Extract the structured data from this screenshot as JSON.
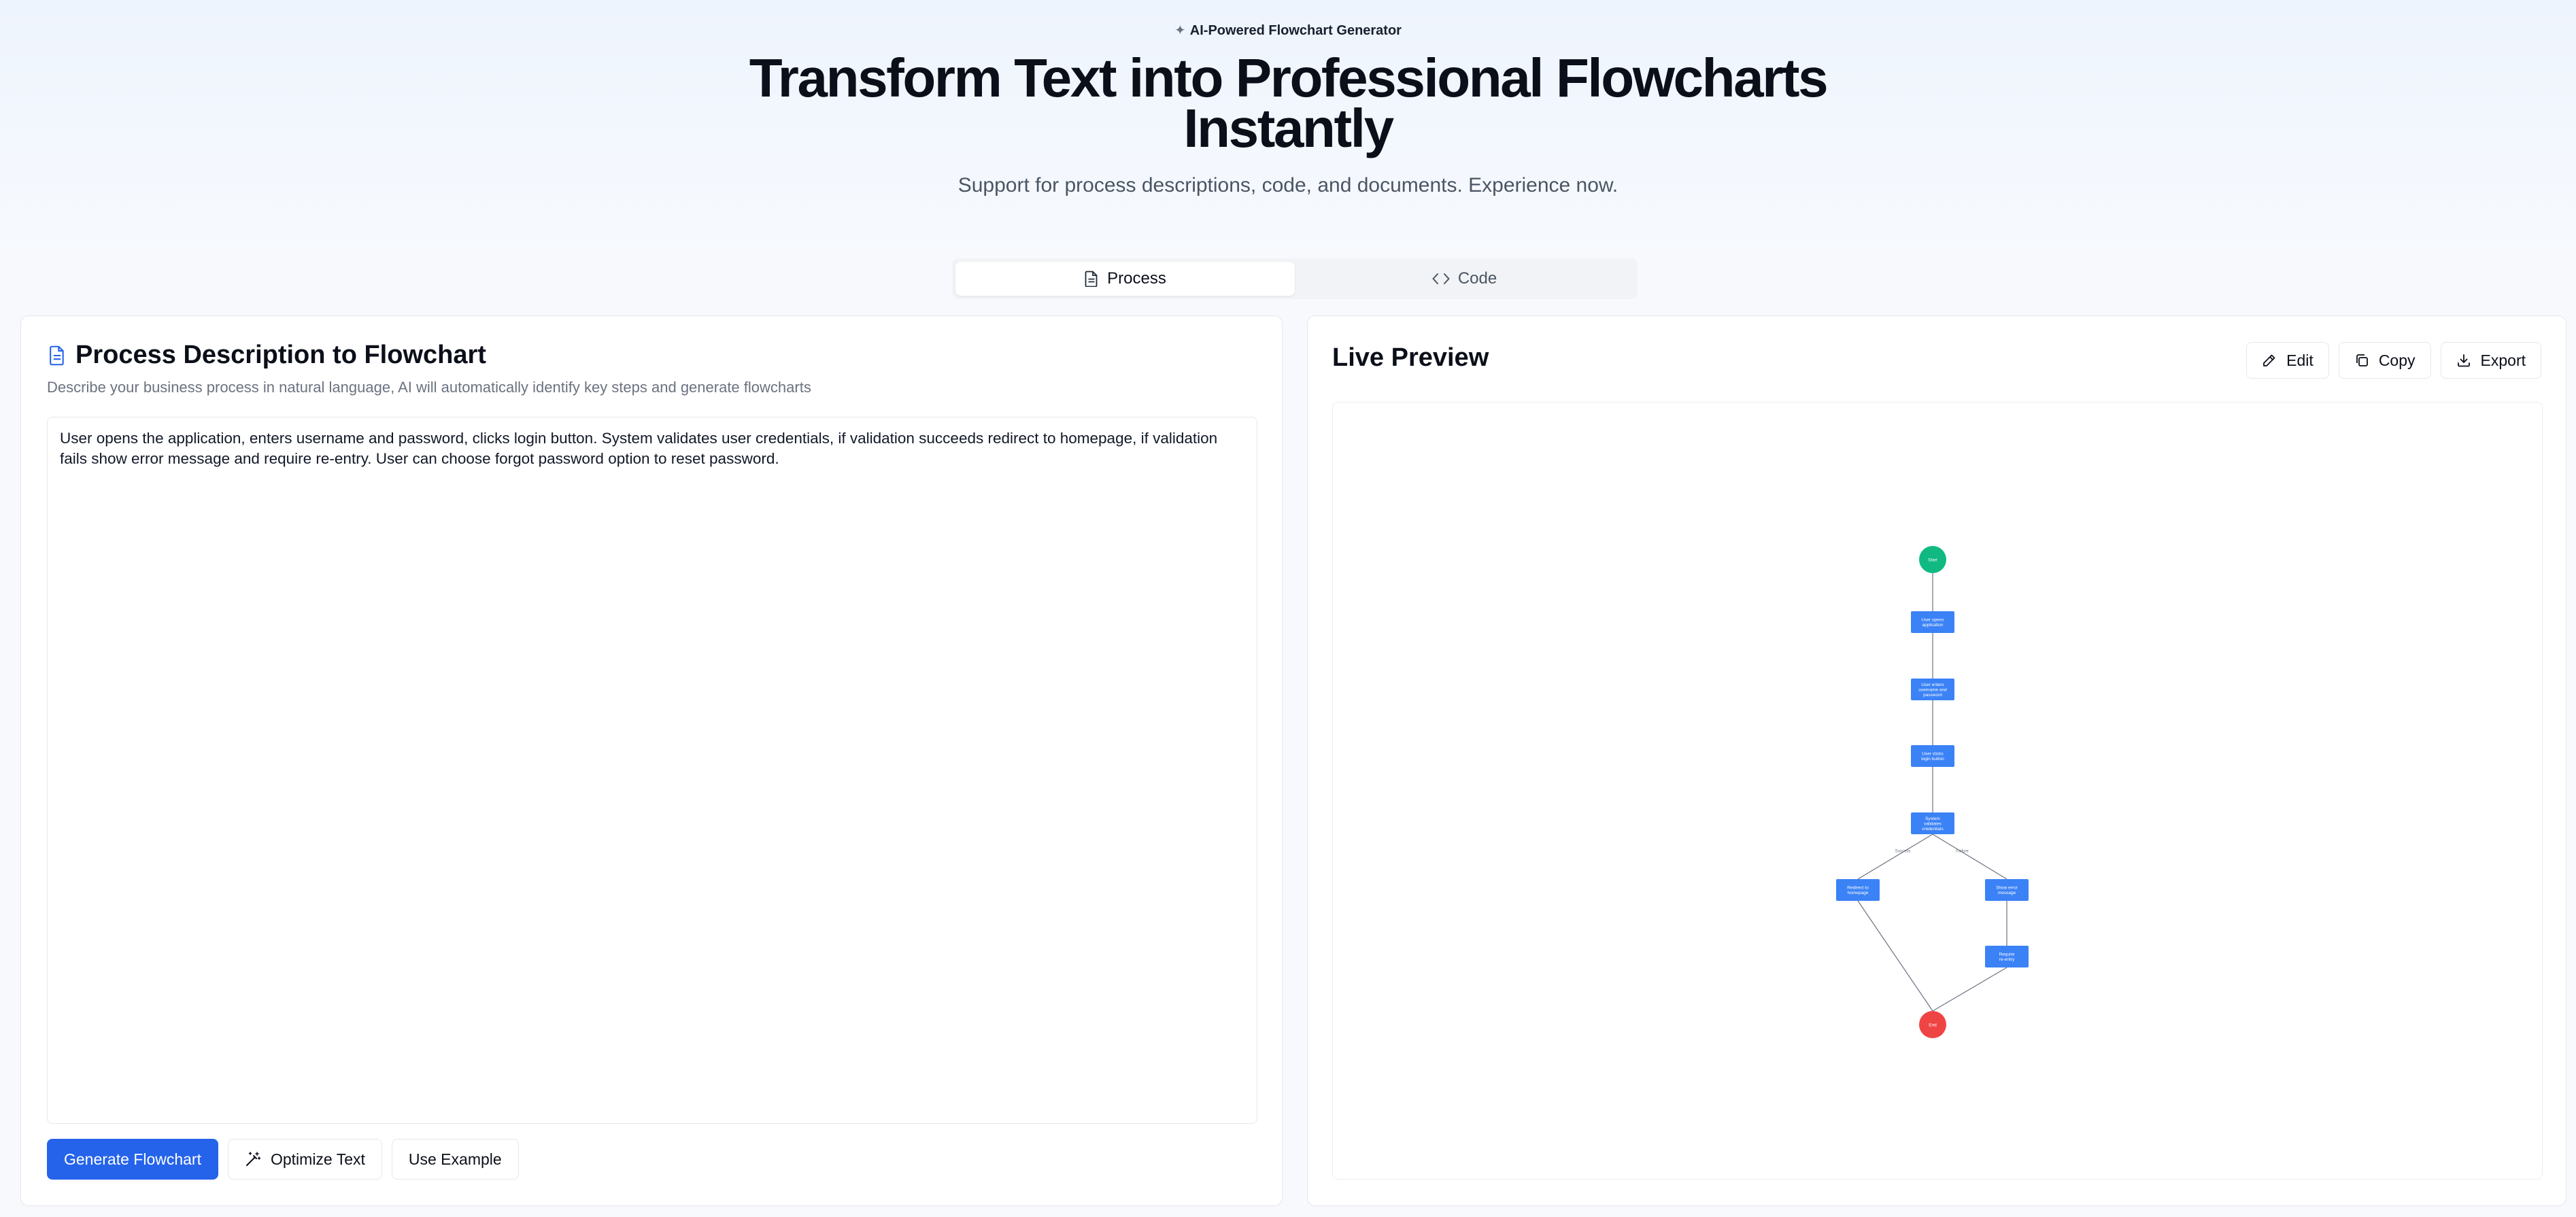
{
  "hero": {
    "badge": "AI-Powered Flowchart Generator",
    "title_line1": "Transform Text into Professional Flowcharts",
    "title_line2": "Instantly",
    "subtitle": "Support for process descriptions, code, and documents. Experience now."
  },
  "tabs": [
    {
      "label": "Process",
      "icon": "document-icon",
      "active": true
    },
    {
      "label": "Code",
      "icon": "code-icon",
      "active": false
    }
  ],
  "left_panel": {
    "title": "Process Description to Flowchart",
    "description": "Describe your business process in natural language, AI will automatically identify key steps and generate flowcharts",
    "input_value": "User opens the application, enters username and password, clicks login button. System validates user credentials, if validation succeeds redirect to homepage, if validation fails show error message and require re-entry. User can choose forgot password option to reset password.",
    "buttons": {
      "generate": "Generate Flowchart",
      "optimize": "Optimize Text",
      "example": "Use Example"
    }
  },
  "right_panel": {
    "title": "Live Preview",
    "actions": {
      "edit": "Edit",
      "copy": "Copy",
      "export": "Export"
    }
  },
  "flowchart": {
    "colors": {
      "start": "#10b981",
      "end": "#ef4444",
      "process": "#3b82f6",
      "edge": "#6b7280"
    },
    "nodes": [
      {
        "id": "start",
        "kind": "start",
        "lines": [
          "Start"
        ]
      },
      {
        "id": "open",
        "kind": "process",
        "lines": [
          "User opens",
          "application"
        ]
      },
      {
        "id": "enter",
        "kind": "process",
        "lines": [
          "User enters",
          "username and",
          "password"
        ]
      },
      {
        "id": "click",
        "kind": "process",
        "lines": [
          "User clicks",
          "login button"
        ]
      },
      {
        "id": "validate",
        "kind": "process",
        "lines": [
          "System",
          "validates",
          "credentials"
        ]
      },
      {
        "id": "redirect",
        "kind": "process",
        "lines": [
          "Redirect to",
          "homepage"
        ]
      },
      {
        "id": "error",
        "kind": "process",
        "lines": [
          "Show error",
          "message"
        ]
      },
      {
        "id": "reentry",
        "kind": "process",
        "lines": [
          "Require",
          "re-entry"
        ]
      },
      {
        "id": "end",
        "kind": "end",
        "lines": [
          "End"
        ]
      }
    ],
    "edges": [
      {
        "from": "start",
        "to": "open",
        "label": ""
      },
      {
        "from": "open",
        "to": "enter",
        "label": ""
      },
      {
        "from": "enter",
        "to": "click",
        "label": ""
      },
      {
        "from": "click",
        "to": "validate",
        "label": ""
      },
      {
        "from": "validate",
        "to": "redirect",
        "label": "Success"
      },
      {
        "from": "validate",
        "to": "error",
        "label": "Failure"
      },
      {
        "from": "error",
        "to": "reentry",
        "label": ""
      },
      {
        "from": "redirect",
        "to": "end",
        "label": ""
      },
      {
        "from": "reentry",
        "to": "end",
        "label": ""
      }
    ]
  }
}
